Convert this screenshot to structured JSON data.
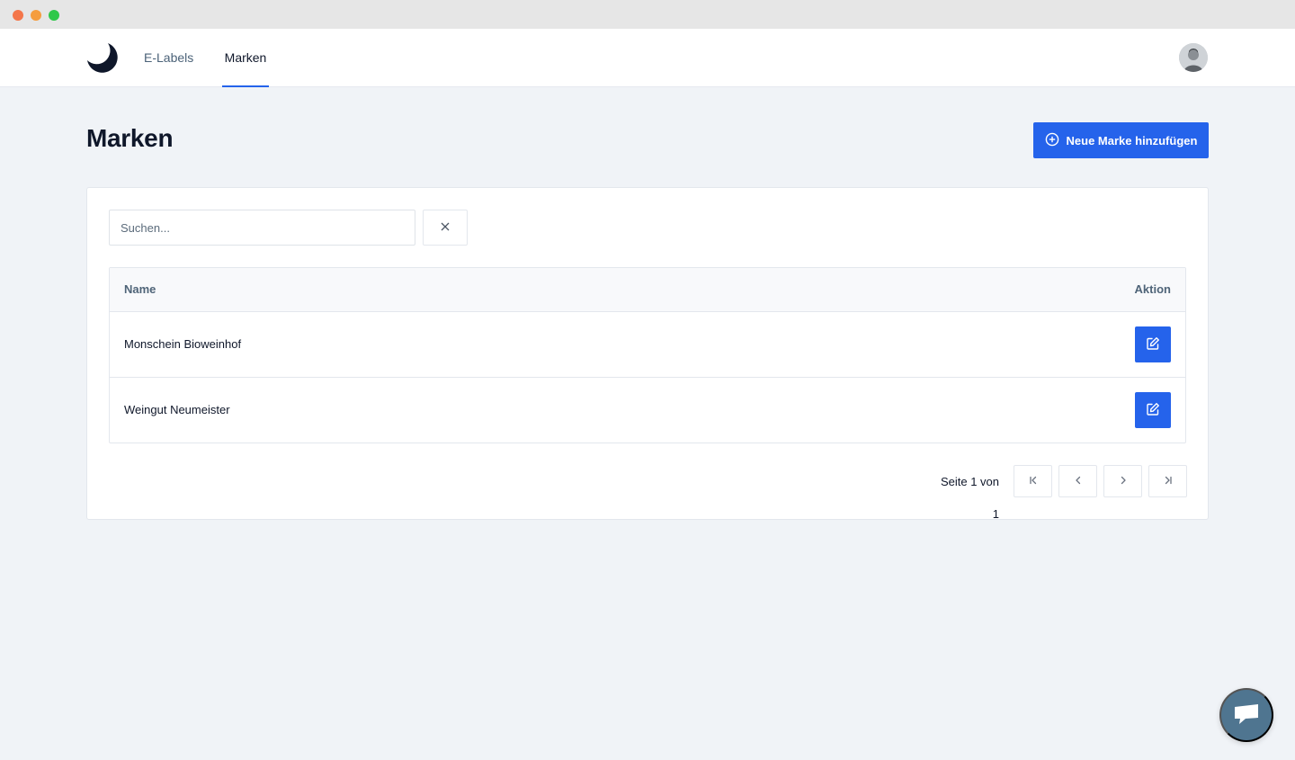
{
  "window": {
    "controls": [
      "close",
      "minimize",
      "maximize"
    ]
  },
  "nav": {
    "logo_icon": "crescent-logo-icon",
    "items": [
      {
        "label": "E-Labels",
        "active": false
      },
      {
        "label": "Marken",
        "active": true
      }
    ],
    "avatar_icon": "user-avatar"
  },
  "page": {
    "title": "Marken",
    "add_button": {
      "label": "Neue Marke hinzufügen",
      "icon": "plus-circle-icon"
    }
  },
  "search": {
    "placeholder": "Suchen...",
    "value": "",
    "clear_icon": "close-icon"
  },
  "table": {
    "columns": [
      "Name",
      "Aktion"
    ],
    "rows": [
      {
        "name": "Monschein Bioweinhof",
        "action_icon": "edit-icon"
      },
      {
        "name": "Weingut Neumeister",
        "action_icon": "edit-icon"
      }
    ]
  },
  "pagination": {
    "label": "Seite 1 von 1",
    "current_page": 1,
    "total_pages": 1,
    "buttons": [
      "first-page-icon",
      "prev-page-icon",
      "next-page-icon",
      "last-page-icon"
    ]
  },
  "chat": {
    "icon": "chat-bubble-icon"
  },
  "colors": {
    "accent": "#2563eb",
    "background": "#f0f3f7",
    "chat": "#4f7590"
  }
}
